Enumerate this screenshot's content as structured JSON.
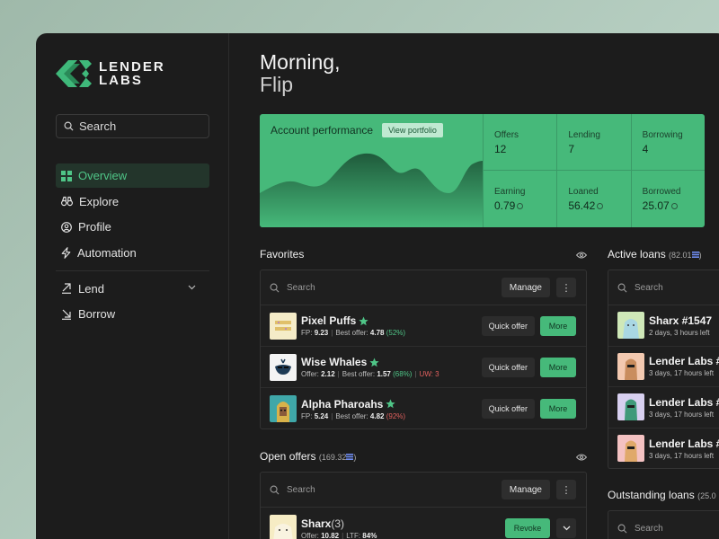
{
  "brand": {
    "line1": "LENDER",
    "line2": "LABS"
  },
  "sidebar": {
    "search_label": "Search",
    "items": [
      {
        "label": "Overview",
        "icon": "grid-icon",
        "active": true
      },
      {
        "label": "Explore",
        "icon": "binoculars-icon"
      },
      {
        "label": "Profile",
        "icon": "user-circle-icon"
      },
      {
        "label": "Automation",
        "icon": "lightning-icon"
      },
      {
        "label": "Lend",
        "icon": "arrow-up-right-icon",
        "expandable": true
      },
      {
        "label": "Borrow",
        "icon": "arrow-down-right-icon"
      }
    ]
  },
  "greeting": {
    "line1": "Morning,",
    "line2": "Flip"
  },
  "performance": {
    "title": "Account performance",
    "view_label": "View portfolio",
    "stats": [
      {
        "label": "Offers",
        "value": "12"
      },
      {
        "label": "Lending",
        "value": "7"
      },
      {
        "label": "Borrowing",
        "value": "4"
      },
      {
        "label": "Earning",
        "value": "0.79"
      },
      {
        "label": "Loaned",
        "value": "56.42"
      },
      {
        "label": "Borrowed",
        "value": "25.07"
      }
    ]
  },
  "favorites": {
    "title": "Favorites",
    "search_placeholder": "Search",
    "manage_label": "Manage",
    "kebab_label": "⋮",
    "quick_label": "Quick offer",
    "more_label": "More",
    "rows": [
      {
        "name": "Pixel Puffs",
        "meta_k1": "FP:",
        "meta_v1": "9.23",
        "meta_k2": "Best offer:",
        "meta_v2": "4.78",
        "meta_pct": "(52%)",
        "uw": ""
      },
      {
        "name": "Wise Whales",
        "meta_k1": "Offer:",
        "meta_v1": "2.12",
        "meta_k2": "Best offer:",
        "meta_v2": "1.57",
        "meta_pct": "(68%)",
        "uw": "UW: 3"
      },
      {
        "name": "Alpha Pharoahs",
        "meta_k1": "FP:",
        "meta_v1": "5.24",
        "meta_k2": "Best offer:",
        "meta_v2": "4.82",
        "meta_pct": "(92%)",
        "uw": ""
      }
    ]
  },
  "open_offers": {
    "title": "Open offers",
    "total": "(169.32",
    "total_end": ")",
    "search_placeholder": "Search",
    "manage_label": "Manage",
    "kebab_label": "⋮",
    "revoke_label": "Revoke",
    "row": {
      "name": "Sharx",
      "count": "(3)",
      "meta_k1": "Offer:",
      "meta_v1": "10.82",
      "meta_k2": "LTF:",
      "meta_v2": "84%"
    }
  },
  "active_loans": {
    "title": "Active loans",
    "total": "(82.01",
    "total_end": ")",
    "search_placeholder": "Search",
    "rows": [
      {
        "name": "Sharx #1547",
        "time": "2 days, 3 hours left"
      },
      {
        "name": "Lender Labs #",
        "time": "3 days, 17 hours left"
      },
      {
        "name": "Lender Labs #",
        "time": "3 days, 17 hours left"
      },
      {
        "name": "Lender Labs #",
        "time": "3 days, 17 hours left"
      }
    ]
  },
  "outstanding_loans": {
    "title": "Outstanding loans",
    "total": "(25.0",
    "search_placeholder": "Search"
  }
}
